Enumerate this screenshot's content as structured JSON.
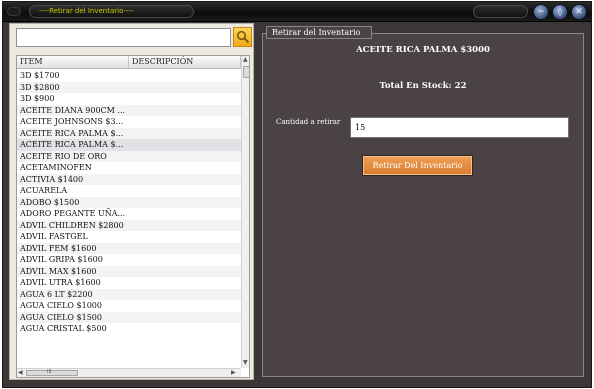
{
  "window": {
    "title": "----Retirar del Inventario----",
    "controls": [
      {
        "name": "minimize",
        "glyph": "−"
      },
      {
        "name": "maximize",
        "glyph": "◊"
      },
      {
        "name": "close",
        "glyph": "✕"
      }
    ]
  },
  "search": {
    "value": "",
    "placeholder": "",
    "button_icon": "search-icon"
  },
  "table": {
    "columns": [
      "ITEM",
      "DESCRIPCIÓN"
    ],
    "rows": [
      "3D $1700",
      "3D $2800",
      "3D $900",
      "ACEITE DIANA 900CM ...",
      "ACEITE JOHNSONS $3...",
      "ACEITE RICA PALMA $...",
      "ACEITE RICA PALMA $...",
      "ACEITE RIO DE ORO",
      "ACETAMINOFEN",
      "ACTIVIA $1400",
      "ACUARELA",
      "ADOBO $1500",
      "ADORO PEGANTE UÑA...",
      "ADVIL CHILDREN $2800",
      "ADVIL FASTGEL",
      "ADVIL FEM $1600",
      "ADVIL GRIPA $1600",
      "ADVIL MAX $1600",
      "ADVIL UTRA $1600",
      "AGUA 6 LT $2200",
      "AGUA CIELO $1000",
      "AGUA CIELO $1500",
      "AGUA CRISTAL $500"
    ],
    "selected_index": 6,
    "hscroll_grip": "III"
  },
  "panel": {
    "legend": "Retirar del Inventario",
    "product": "ACEITE RICA PALMA $3000",
    "stock_text": "Total En Stock: 22",
    "quantity_label": "Cantidad a retirar",
    "quantity_value": "15",
    "submit_label": "Retirar Del Inventario"
  },
  "colors": {
    "window_bg": "#3d3637",
    "panel_bg": "#4a4243",
    "accent_orange": "#e08a3a",
    "search_yellow": "#f5b82a",
    "title_text": "#c8c800"
  }
}
